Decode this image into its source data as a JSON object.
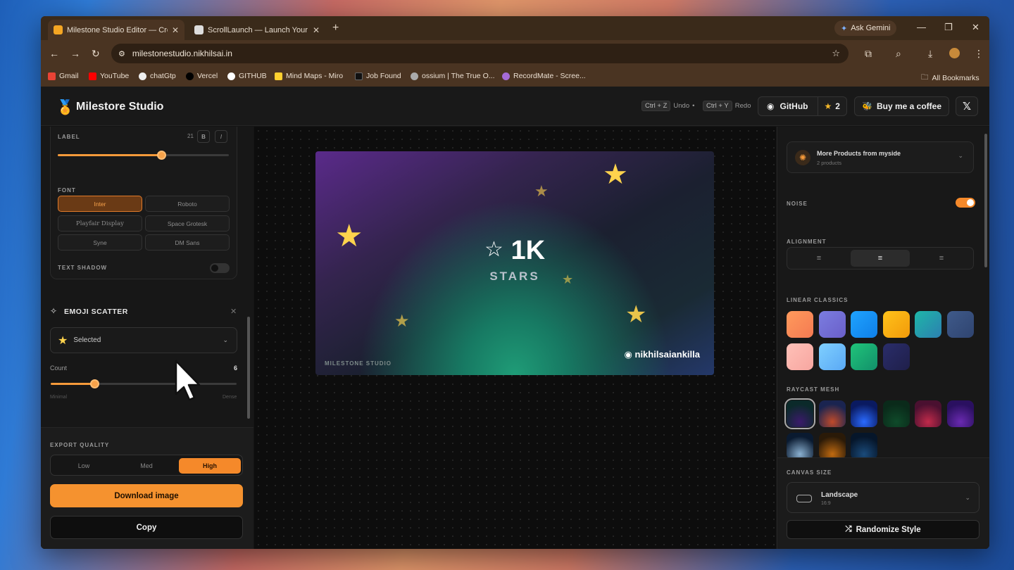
{
  "browser": {
    "tabs": [
      {
        "title": "Milestone Studio Editor — Crea"
      },
      {
        "title": "ScrollLaunch — Launch Your Pr"
      }
    ],
    "ask_gemini": "Ask Gemini",
    "url": "milestonestudio.nikhilsai.in",
    "bookmarks": [
      "Gmail",
      "YouTube",
      "chatGtp",
      "Vercel",
      "GITHUB",
      "Mind Maps - Miro",
      "Job Found",
      "ossium | The True O...",
      "RecordMate - Scree..."
    ],
    "all_bookmarks": "All Bookmarks"
  },
  "header": {
    "brand": "Milestore Studio",
    "undo_key": "Ctrl + Z",
    "undo": "Undo",
    "redo_key": "Ctrl + Y",
    "redo": "Redo",
    "github": "GitHub",
    "stars": "2",
    "coffee": "Buy me a coffee"
  },
  "left": {
    "label_title": "LABEL",
    "label_size": "21",
    "bold": "B",
    "italic": "I",
    "font_title": "FONT",
    "fonts": [
      "Inter",
      "Roboto",
      "Playfair Display",
      "Space Grotesk",
      "Syne",
      "DM Sans"
    ],
    "text_shadow": "TEXT SHADOW",
    "emoji_title": "EMOJI SCATTER",
    "emoji_selected": "Selected",
    "count_label": "Count",
    "count_value": "6",
    "min_label": "Minimal",
    "max_label": "Dense",
    "export_title": "EXPORT QUALITY",
    "quality": [
      "Low",
      "Med",
      "High"
    ],
    "download": "Download image",
    "copy": "Copy"
  },
  "preview": {
    "value": "1K",
    "unit": "STARS",
    "watermark": "MILESTONE STUDIO",
    "handle": "nikhilsaiankilla"
  },
  "right": {
    "products_title": "More Products from myside",
    "products_sub": "2 products",
    "noise": "NOISE",
    "alignment": "ALIGNMENT",
    "linear_title": "LINEAR CLASSICS",
    "linear_colors": [
      [
        "#ff9a5c",
        "#f47a52"
      ],
      [
        "#7b7de0",
        "#6a5fc9"
      ],
      [
        "#1fa3ff",
        "#0f7fe8"
      ],
      [
        "#ffc21a",
        "#f29a0a"
      ],
      [
        "#1eb7a8",
        "#2c7fb0"
      ],
      [
        "#3f5a8a",
        "#2f4470"
      ],
      [
        "#ffc1b8",
        "#f7a6a0"
      ],
      [
        "#7fd0ff",
        "#5aa8f5"
      ],
      [
        "#20c47a",
        "#12906a"
      ],
      [
        "#2a2d6a",
        "#1f1f4a"
      ]
    ],
    "raycast_title": "RAYCAST MESH",
    "raycast_colors": [
      [
        "#0b2a2a",
        "#3a1a6a"
      ],
      [
        "#1a2450",
        "#c04a2a"
      ],
      [
        "#0a1a60",
        "#2a6aff"
      ],
      [
        "#0a2a1a",
        "#0f4a2a"
      ],
      [
        "#4a1030",
        "#c02a4a"
      ],
      [
        "#2a1060",
        "#6a2ab0"
      ],
      [
        "#0a1a30",
        "#8ab0d0"
      ],
      [
        "#2a1a08",
        "#c06a10"
      ],
      [
        "#06162a",
        "#1a4a7a"
      ]
    ],
    "canvas_size_title": "CANVAS SIZE",
    "canvas_name": "Landscape",
    "canvas_ratio": "16:9",
    "randomize": "Randomize Style"
  }
}
